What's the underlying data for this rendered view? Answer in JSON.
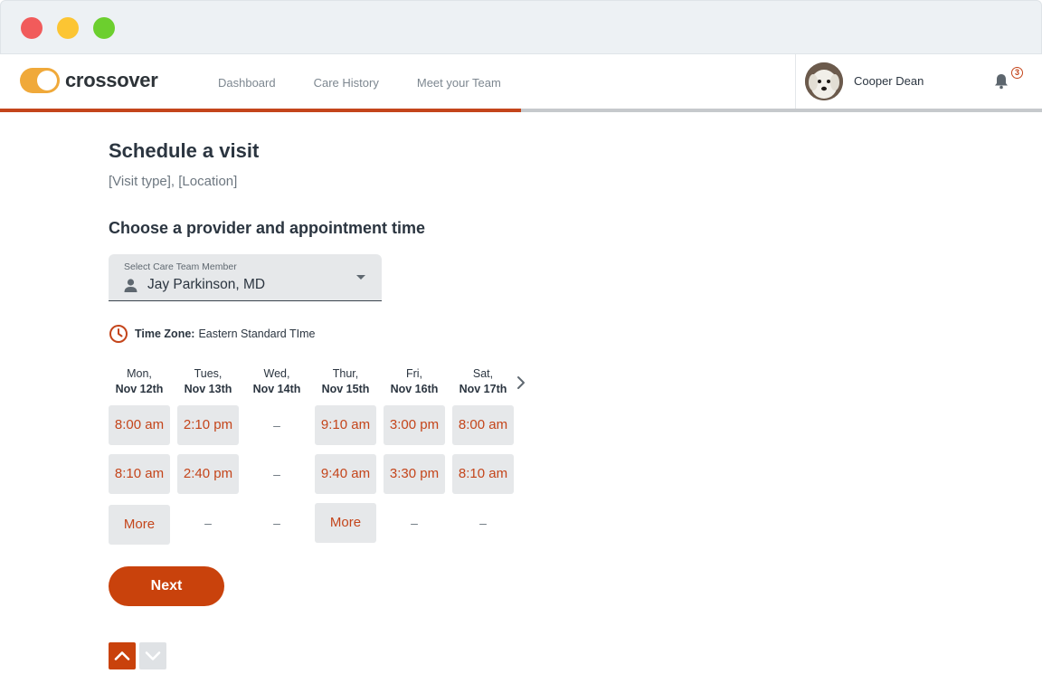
{
  "window": {
    "buttons": [
      "close",
      "minimize",
      "maximize"
    ]
  },
  "brand": {
    "name": "crossover",
    "accent": "#c4451b",
    "logo_color": "#f0a93a"
  },
  "nav": {
    "items": [
      "Dashboard",
      "Care History",
      "Meet your Team"
    ]
  },
  "progress": {
    "fraction": 0.5
  },
  "user": {
    "name": "Cooper Dean",
    "notification_count": "3"
  },
  "page": {
    "title": "Schedule a visit",
    "subtitle": "[Visit type], [Location]",
    "section_title": "Choose a provider and appointment time"
  },
  "care_team_select": {
    "label": "Select Care Team Member",
    "value": "Jay Parkinson, MD"
  },
  "timezone": {
    "label": "Time Zone:",
    "value": "Eastern Standard TIme"
  },
  "schedule": {
    "days": [
      {
        "name": "Mon,",
        "date": "Nov 12th"
      },
      {
        "name": "Tues,",
        "date": "Nov 13th"
      },
      {
        "name": "Wed,",
        "date": "Nov 14th"
      },
      {
        "name": "Thur,",
        "date": "Nov 15th"
      },
      {
        "name": "Fri,",
        "date": "Nov 16th"
      },
      {
        "name": "Sat,",
        "date": "Nov 17th"
      }
    ],
    "rows": [
      [
        "8:00 am",
        "2:10 pm",
        "–",
        "9:10 am",
        "3:00 pm",
        "8:00 am"
      ],
      [
        "8:10 am",
        "2:40 pm",
        "–",
        "9:40 am",
        "3:30 pm",
        "8:10 am"
      ],
      [
        "More",
        "–",
        "–",
        "More",
        "–",
        "–"
      ]
    ],
    "empty_marker": "–"
  },
  "actions": {
    "next_label": "Next"
  }
}
